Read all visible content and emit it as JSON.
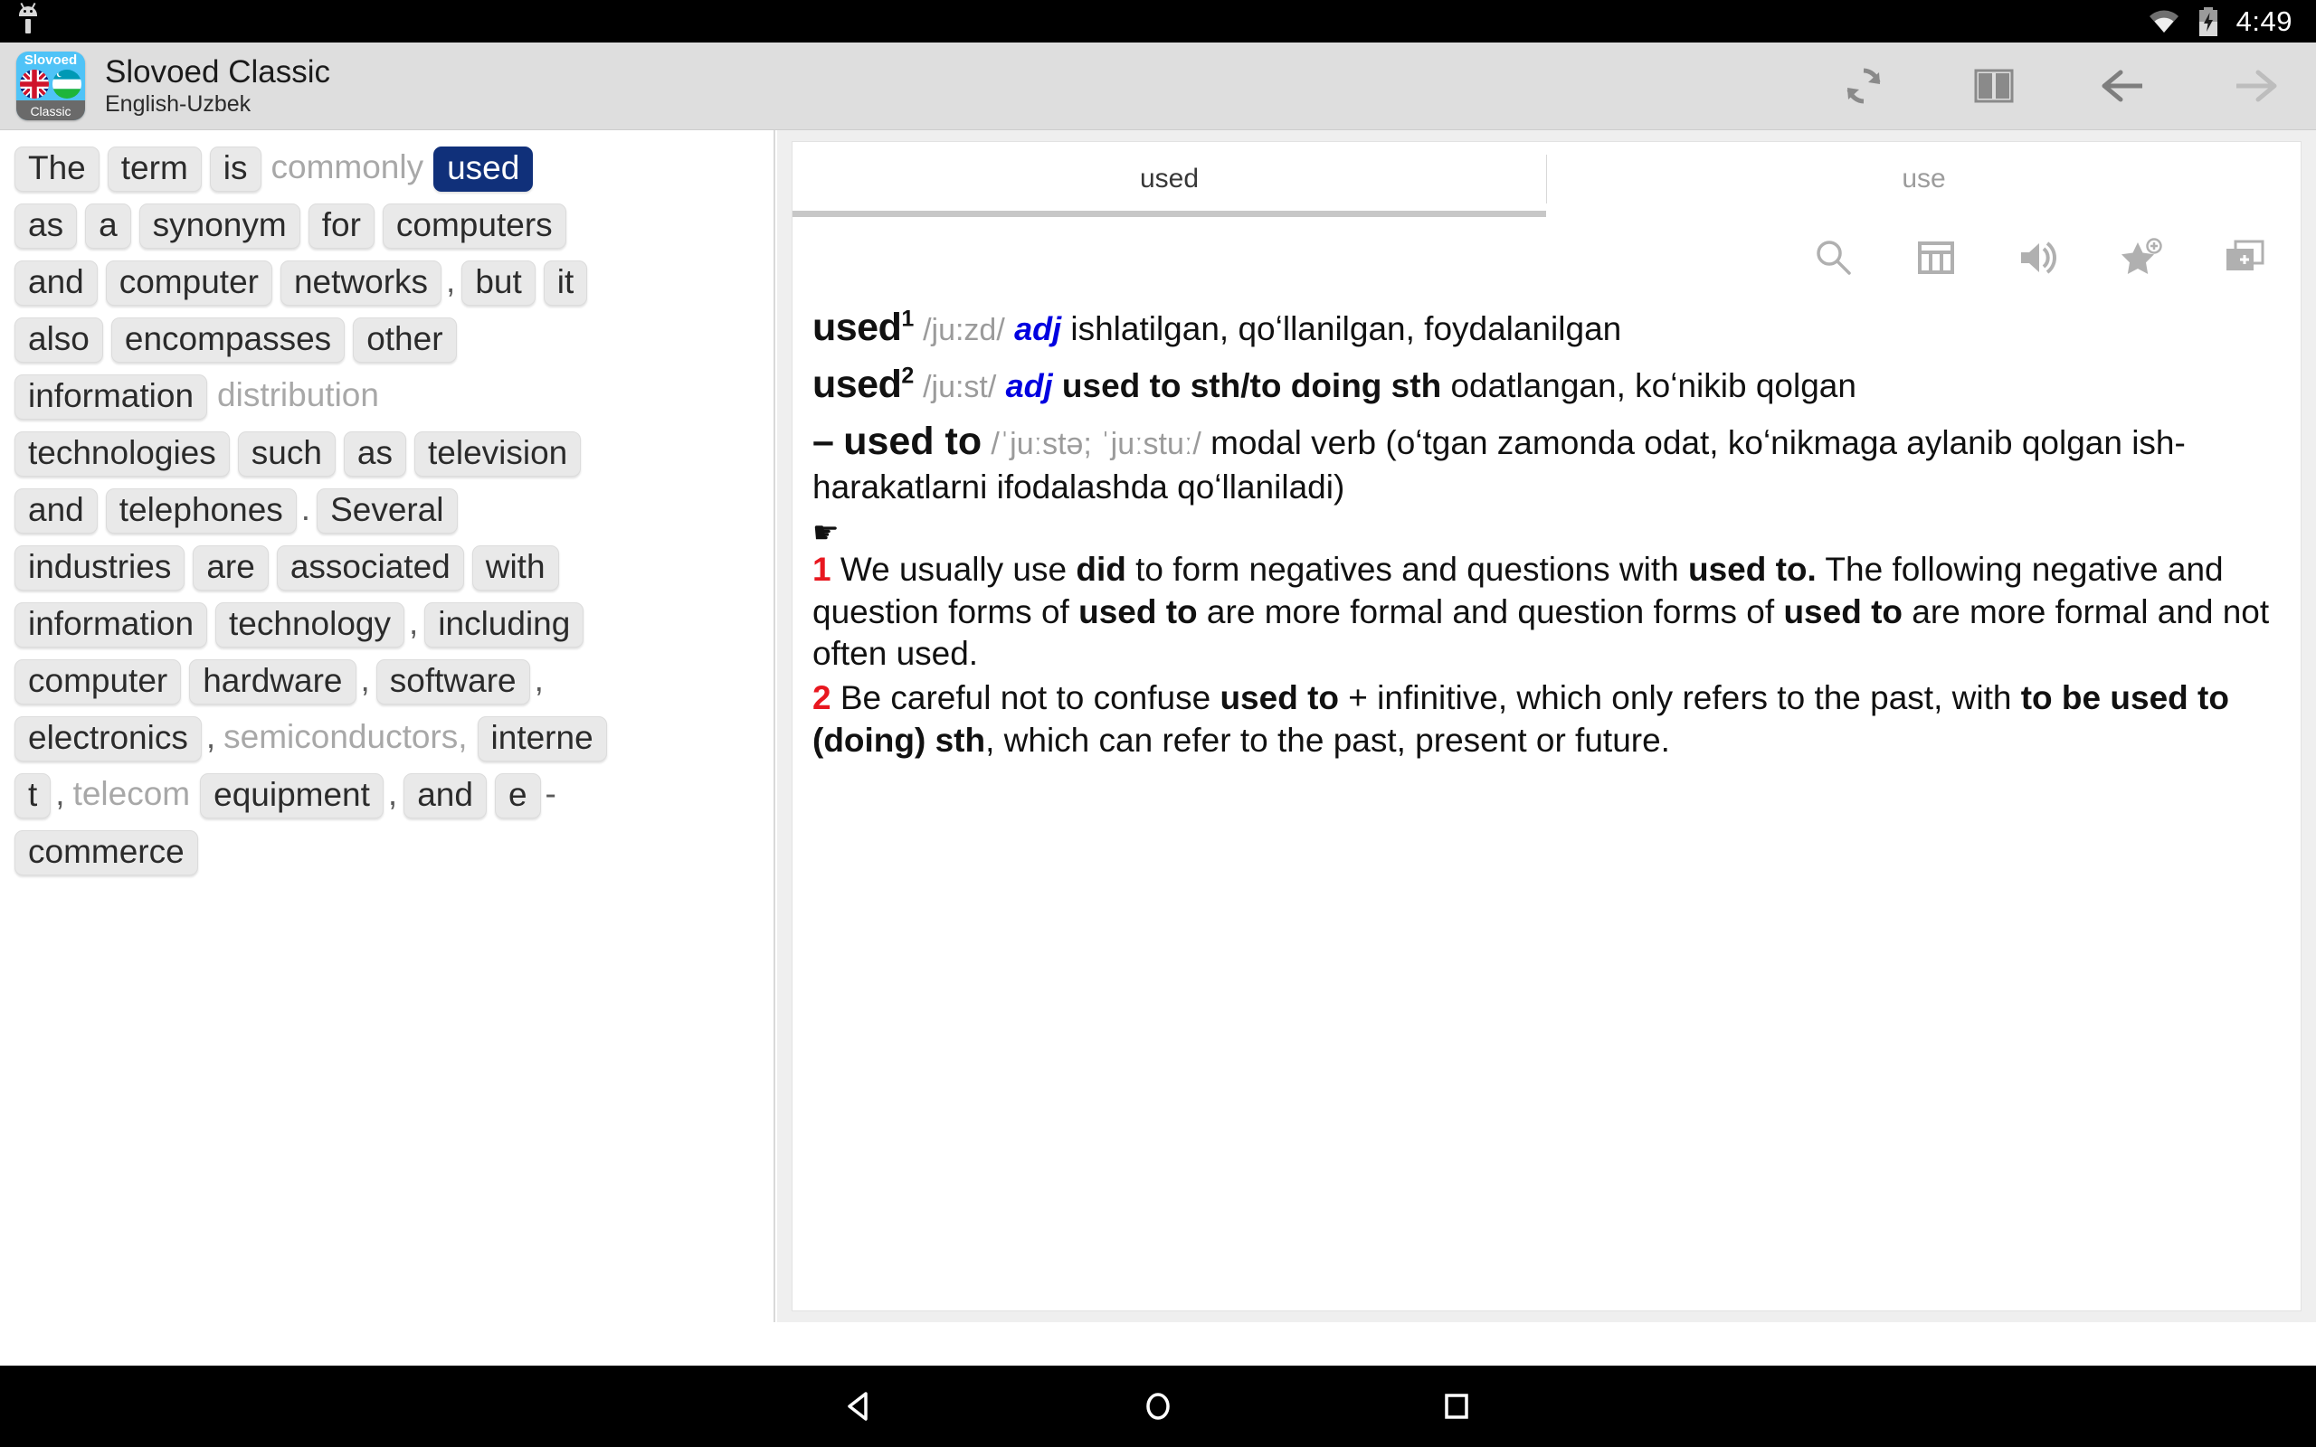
{
  "status_bar": {
    "time": "4:49",
    "icons": [
      "android-robot-icon",
      "wifi-icon",
      "battery-charging-icon"
    ]
  },
  "header": {
    "app_title": "Slovoed Classic",
    "app_subtitle": "English-Uzbek",
    "app_icon": {
      "top_label": "Slovoed",
      "bottom_label": "Classic"
    },
    "actions": [
      {
        "name": "sync-icon",
        "label": "Sync"
      },
      {
        "name": "book-icon",
        "label": "Dictionaries"
      },
      {
        "name": "back-arrow-icon",
        "label": "Back"
      },
      {
        "name": "forward-arrow-icon",
        "label": "Forward"
      }
    ]
  },
  "word_pane": {
    "tokens": [
      {
        "text": "The",
        "type": "chip"
      },
      {
        "text": "term",
        "type": "chip"
      },
      {
        "text": "is",
        "type": "chip"
      },
      {
        "text": "commonly",
        "type": "plain"
      },
      {
        "text": "used",
        "type": "chip",
        "selected": true
      },
      {
        "break": true
      },
      {
        "text": "as",
        "type": "chip"
      },
      {
        "text": "a",
        "type": "chip"
      },
      {
        "text": "synonym",
        "type": "chip"
      },
      {
        "text": "for",
        "type": "chip"
      },
      {
        "text": "computers",
        "type": "chip"
      },
      {
        "break": true
      },
      {
        "text": "and",
        "type": "chip"
      },
      {
        "text": "computer",
        "type": "chip"
      },
      {
        "text": "networks",
        "type": "chip"
      },
      {
        "text": ",",
        "type": "punct"
      },
      {
        "text": "but",
        "type": "chip"
      },
      {
        "text": "it",
        "type": "chip"
      },
      {
        "break": true
      },
      {
        "text": "also",
        "type": "chip"
      },
      {
        "text": "encompasses",
        "type": "chip"
      },
      {
        "text": "other",
        "type": "chip"
      },
      {
        "break": true
      },
      {
        "text": "information",
        "type": "chip"
      },
      {
        "text": "distribution",
        "type": "plain"
      },
      {
        "break": true
      },
      {
        "text": "technologies",
        "type": "chip"
      },
      {
        "text": "such",
        "type": "chip"
      },
      {
        "text": "as",
        "type": "chip"
      },
      {
        "text": "television",
        "type": "chip"
      },
      {
        "break": true
      },
      {
        "text": "and",
        "type": "chip"
      },
      {
        "text": "telephones",
        "type": "chip"
      },
      {
        "text": ".",
        "type": "punct"
      },
      {
        "text": "Several",
        "type": "chip"
      },
      {
        "break": true
      },
      {
        "text": "industries",
        "type": "chip"
      },
      {
        "text": "are",
        "type": "chip"
      },
      {
        "text": "associated",
        "type": "chip"
      },
      {
        "text": "with",
        "type": "chip"
      },
      {
        "break": true
      },
      {
        "text": "information",
        "type": "chip"
      },
      {
        "text": "technology",
        "type": "chip"
      },
      {
        "text": ",",
        "type": "punct"
      },
      {
        "text": "including",
        "type": "chip"
      },
      {
        "break": true
      },
      {
        "text": "computer",
        "type": "chip"
      },
      {
        "text": "hardware",
        "type": "chip"
      },
      {
        "text": ",",
        "type": "punct"
      },
      {
        "text": "software",
        "type": "chip"
      },
      {
        "text": ",",
        "type": "punct"
      },
      {
        "break": true
      },
      {
        "text": "electronics",
        "type": "chip"
      },
      {
        "text": ",",
        "type": "punct"
      },
      {
        "text": "semiconductors,",
        "type": "plain"
      },
      {
        "text": "interne",
        "type": "chip"
      },
      {
        "break": true
      },
      {
        "text": "t",
        "type": "chip"
      },
      {
        "text": ",",
        "type": "punct"
      },
      {
        "text": "telecom",
        "type": "plain"
      },
      {
        "text": "equipment",
        "type": "chip"
      },
      {
        "text": ",",
        "type": "punct"
      },
      {
        "text": "and",
        "type": "chip"
      },
      {
        "text": "e",
        "type": "chip"
      },
      {
        "text": "-",
        "type": "punct"
      },
      {
        "break": true
      },
      {
        "text": "commerce",
        "type": "chip"
      }
    ]
  },
  "article": {
    "tabs": [
      {
        "label": "used",
        "active": true
      },
      {
        "label": "use",
        "active": false
      }
    ],
    "toolbar": [
      {
        "name": "search-icon",
        "label": "Search"
      },
      {
        "name": "table-icon",
        "label": "Tables"
      },
      {
        "name": "sound-icon",
        "label": "Pronounce"
      },
      {
        "name": "star-plus-icon",
        "label": "Add to favorites"
      },
      {
        "name": "new-card-icon",
        "label": "Open in new card"
      }
    ],
    "entries": [
      {
        "headword": "used",
        "sup": "1",
        "phonetic": "/ju:zd/",
        "pos": "adj",
        "translation": "ishlatilgan, qoʻllanilgan, foydalanilgan"
      },
      {
        "headword": "used",
        "sup": "2",
        "phonetic": "/ju:st/",
        "pos": "adj",
        "pattern": "used to sth/to doing sth",
        "translation": "odatlangan, koʻnikib qolgan"
      }
    ],
    "subentry": {
      "dash": "–",
      "headword": "used to",
      "phonetic": "/ˈjuːstə; ˈjuːstuː/",
      "gloss": "modal verb (oʻtgan zamonda odat, koʻnikmaga aylanib qolgan ish-harakatlarni ifodalashda qoʻllaniladi)"
    },
    "hand_glyph": "☛",
    "notes": [
      {
        "num": "1",
        "parts": [
          {
            "t": "We usually use "
          },
          {
            "t": "did",
            "b": true
          },
          {
            "t": " to form negatives and questions with "
          },
          {
            "t": "used to.",
            "b": true
          },
          {
            "t": " The following negative and question forms of "
          },
          {
            "t": "used to",
            "b": true
          },
          {
            "t": " are more formal and question forms of "
          },
          {
            "t": "used to",
            "b": true
          },
          {
            "t": " are more formal and not often used."
          }
        ]
      },
      {
        "num": "2",
        "parts": [
          {
            "t": "Be careful not to confuse "
          },
          {
            "t": "used to",
            "b": true
          },
          {
            "t": " + infinitive, which only refers to the past, with "
          },
          {
            "t": "to be used to (doing) sth",
            "b": true
          },
          {
            "t": ", which can refer to the past, present or future."
          }
        ]
      }
    ]
  },
  "nav_bar": {
    "buttons": [
      {
        "name": "nav-back-icon",
        "label": "Back"
      },
      {
        "name": "nav-home-icon",
        "label": "Home"
      },
      {
        "name": "nav-recents-icon",
        "label": "Recents"
      }
    ]
  },
  "colors": {
    "selected_chip": "#10307a",
    "note_number": "#e8171f",
    "pos_blue": "#0000e0",
    "header_bg": "#dedede"
  }
}
